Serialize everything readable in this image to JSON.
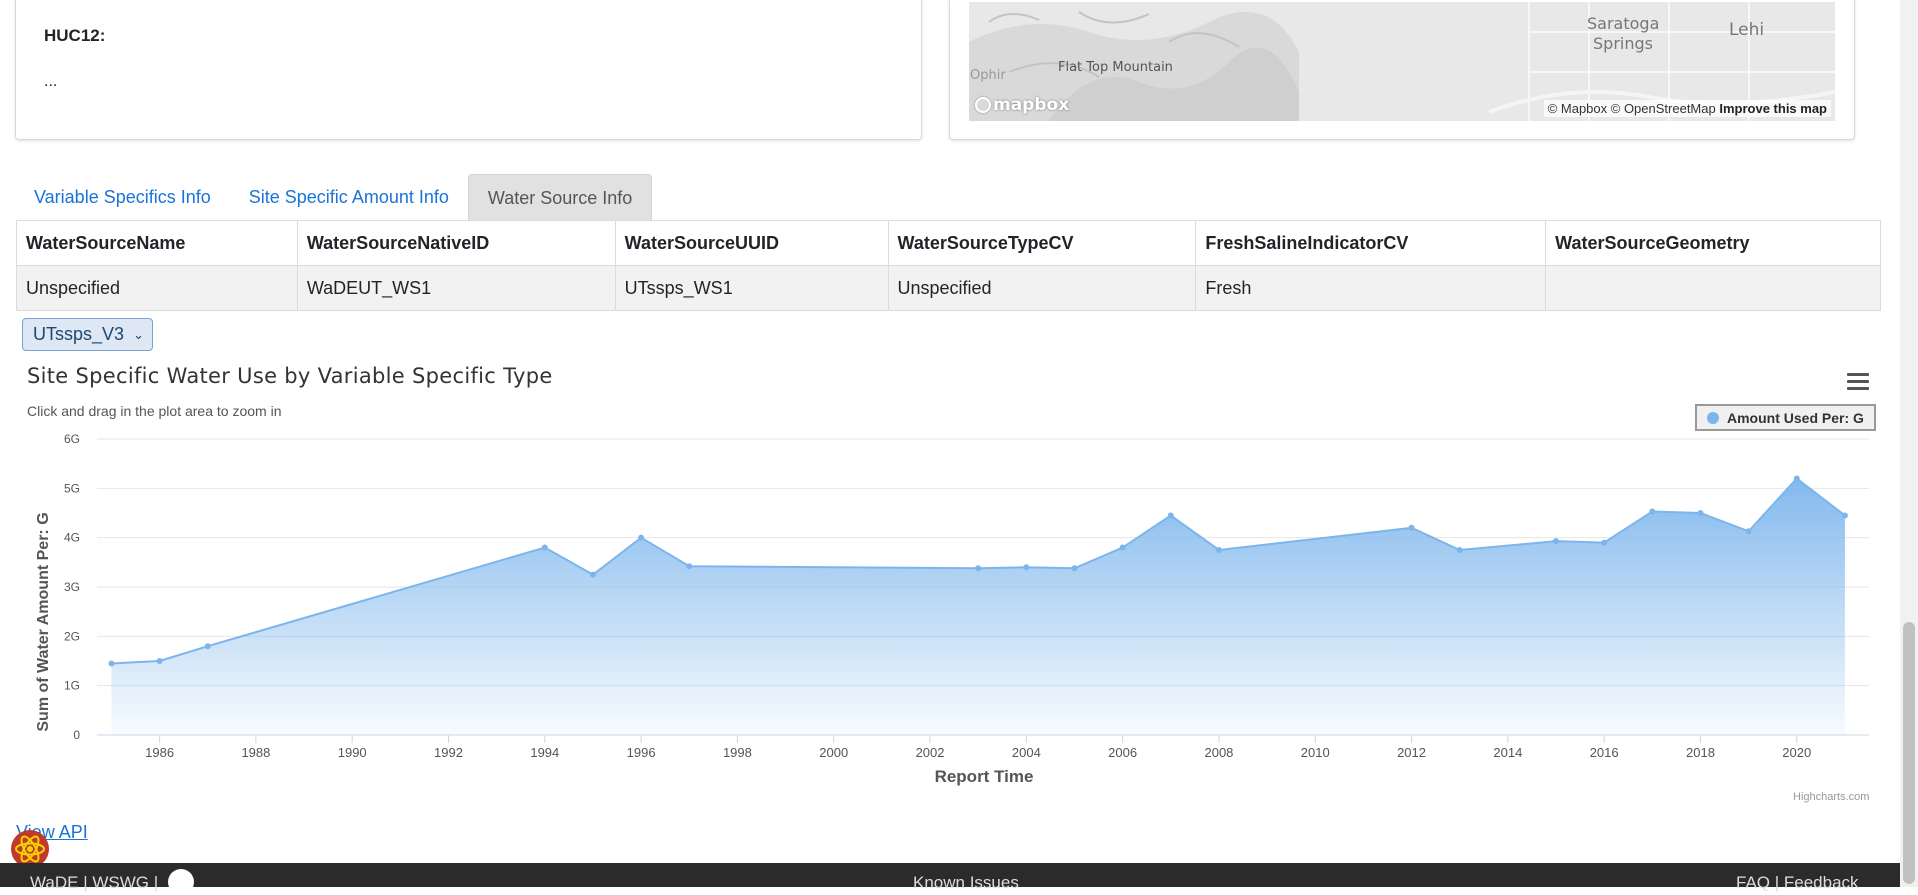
{
  "huc": {
    "label": "HUC12:",
    "value": "..."
  },
  "map": {
    "places": [
      "Saratoga",
      "Springs",
      "Lehi",
      "Flat Top Mountain",
      "Ophir"
    ],
    "logo_text": "mapbox",
    "attribution": "© Mapbox © OpenStreetMap",
    "improve_link": "Improve this map"
  },
  "tabs": [
    {
      "label": "Variable Specifics Info",
      "active": false
    },
    {
      "label": "Site Specific Amount Info",
      "active": false
    },
    {
      "label": "Water Source Info",
      "active": true
    }
  ],
  "table": {
    "headers": [
      "WaterSourceName",
      "WaterSourceNativeID",
      "WaterSourceUUID",
      "WaterSourceTypeCV",
      "FreshSalineIndicatorCV",
      "WaterSourceGeometry"
    ],
    "rows": [
      [
        "Unspecified",
        "WaDEUT_WS1",
        "UTssps_WS1",
        "Unspecified",
        "Fresh",
        ""
      ]
    ]
  },
  "dropdown": {
    "selected": "UTssps_V3"
  },
  "chart_data": {
    "type": "area",
    "title": "Site Specific Water Use by Variable Specific Type",
    "subtitle": "Click and drag in the plot area to zoom in",
    "xlabel": "Report Time",
    "ylabel": "Sum of Water Amount Per: G",
    "ylim": [
      0,
      6000000000
    ],
    "xlim": [
      1984.7,
      2021.5
    ],
    "y_tick_labels": [
      "0",
      "1G",
      "2G",
      "3G",
      "4G",
      "5G",
      "6G"
    ],
    "x_tick_labels": [
      "1986",
      "1988",
      "1990",
      "1992",
      "1994",
      "1996",
      "1998",
      "2000",
      "2002",
      "2004",
      "2006",
      "2008",
      "2010",
      "2012",
      "2014",
      "2016",
      "2018",
      "2020"
    ],
    "grid": true,
    "legend_position": "top-right",
    "color": "#7cb5ec",
    "series": [
      {
        "name": "Amount Used Per: G",
        "x": [
          1985,
          1986,
          1987,
          1994,
          1995,
          1996,
          1997,
          2003,
          2004,
          2005,
          2006,
          2007,
          2008,
          2012,
          2013,
          2015,
          2016,
          2017,
          2018,
          2019,
          2020,
          2021
        ],
        "values": [
          1450000000,
          1500000000,
          1800000000,
          3800000000,
          3250000000,
          4000000000,
          3420000000,
          3380000000,
          3400000000,
          3380000000,
          3800000000,
          4450000000,
          3750000000,
          4200000000,
          3750000000,
          3930000000,
          3900000000,
          4530000000,
          4500000000,
          4130000000,
          5200000000,
          4450000000
        ]
      }
    ],
    "credits": "Highcharts.com"
  },
  "links": {
    "view_api": "View API"
  },
  "footer": {
    "left": "WaDE | WSWG |",
    "middle": "Known Issues",
    "right": "FAQ | Feedback"
  }
}
